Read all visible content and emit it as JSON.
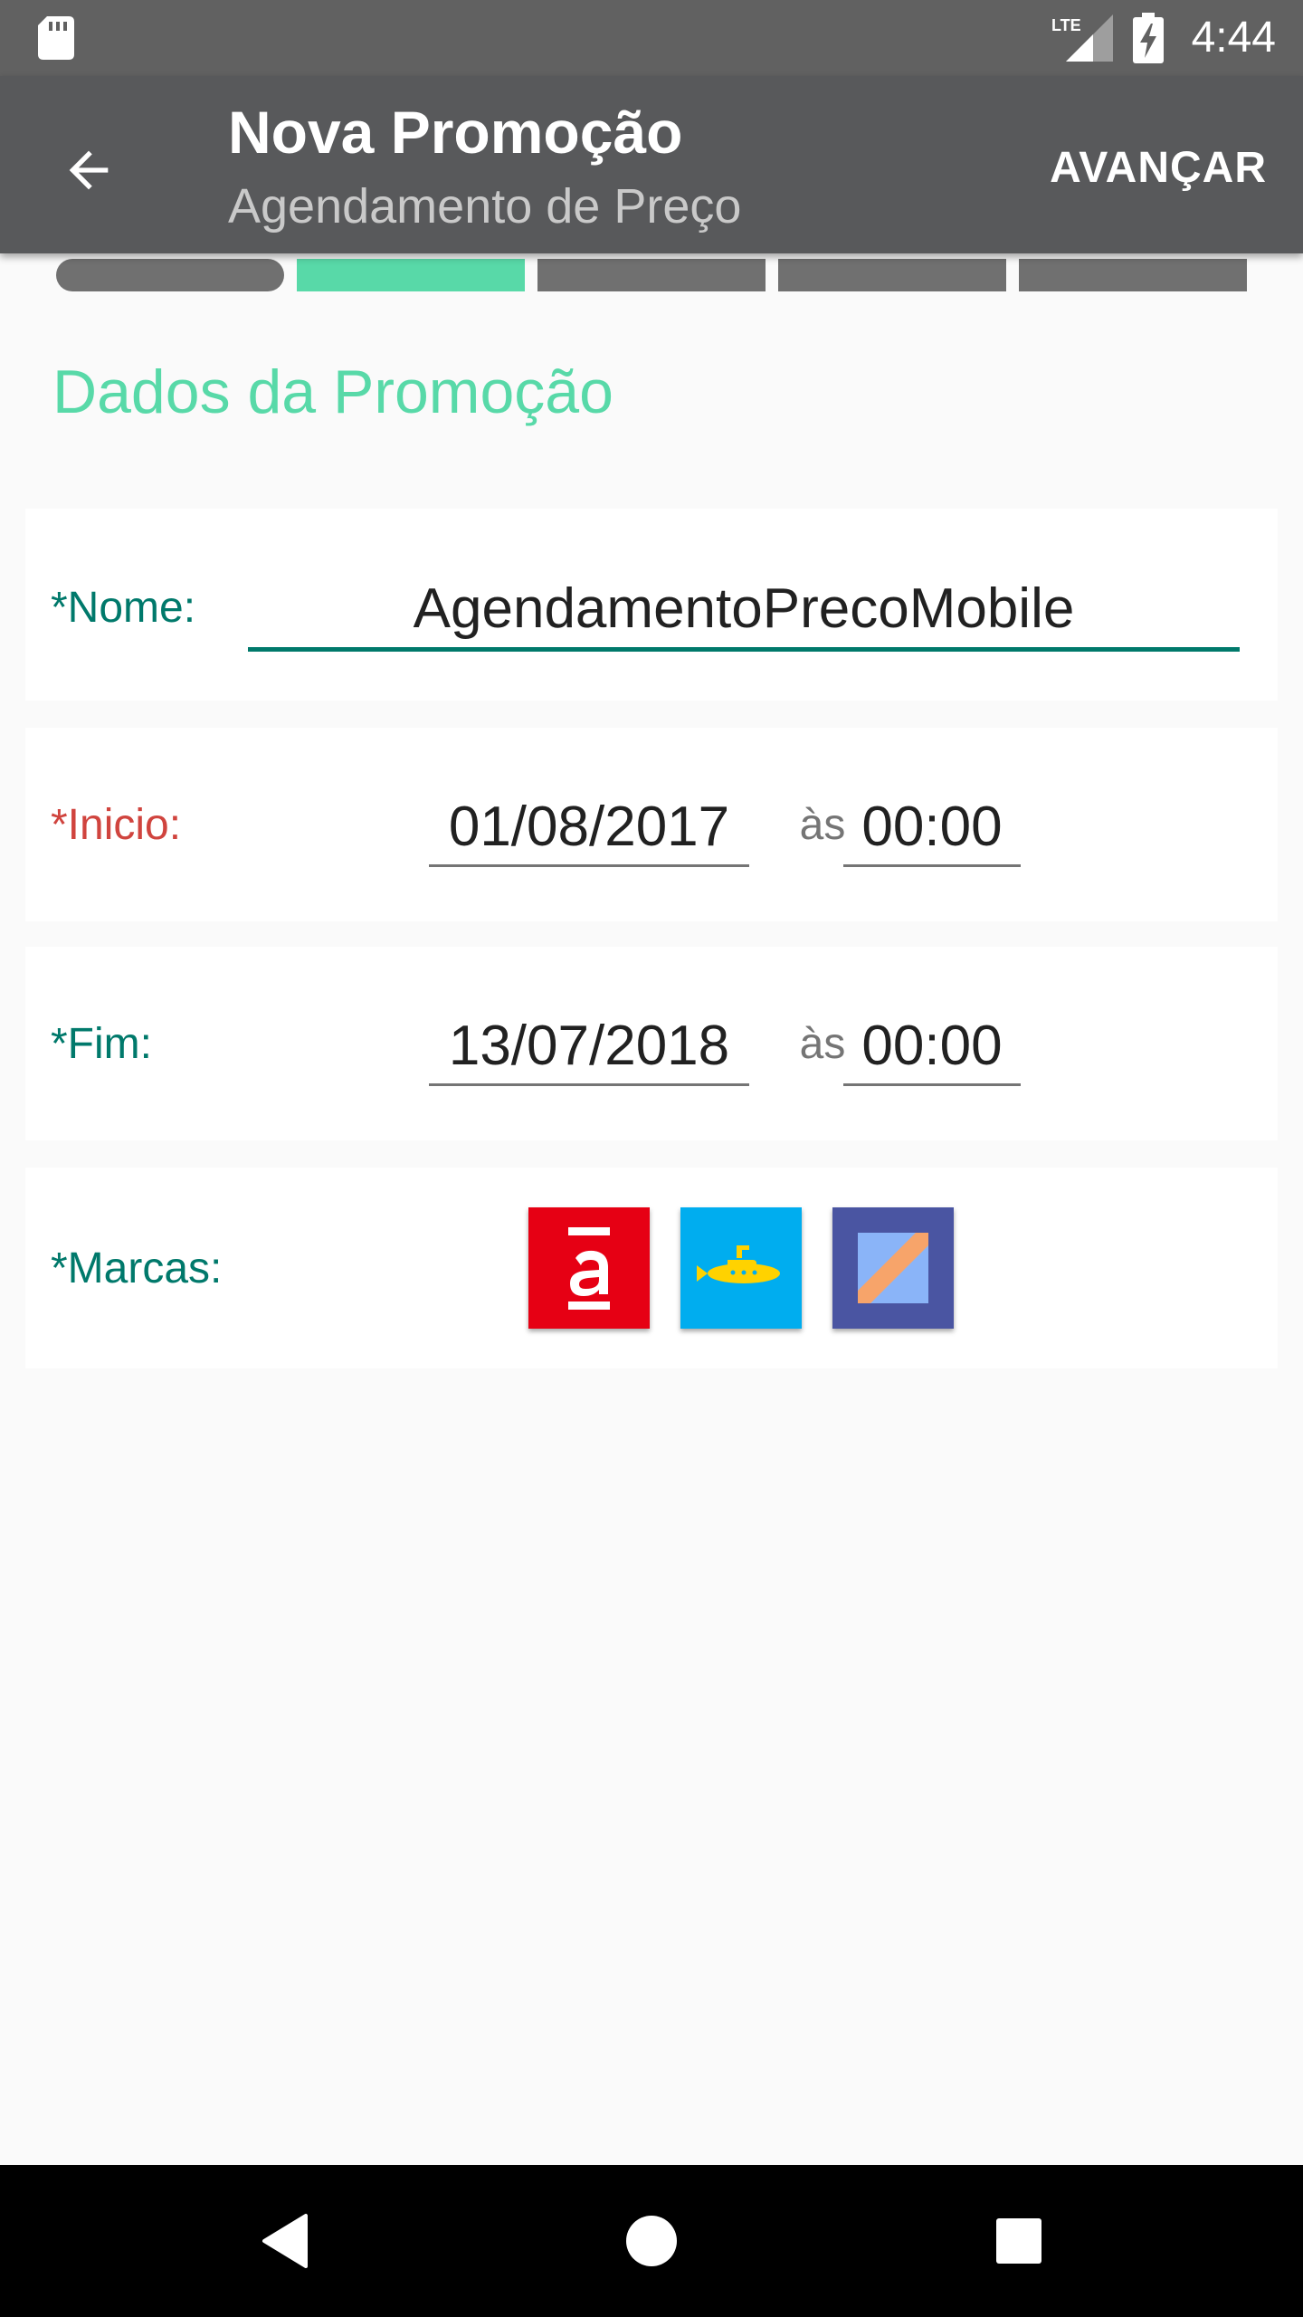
{
  "status_bar": {
    "time": "4:44",
    "network_label": "LTE",
    "icons": [
      "sd-card-icon",
      "lte-signal-icon",
      "battery-charging-icon"
    ]
  },
  "app_bar": {
    "title": "Nova Promoção",
    "subtitle": "Agendamento de Preço",
    "next_label": "AVANÇAR",
    "back_icon": "arrow-back-icon"
  },
  "steps": {
    "total": 5,
    "active_index": 1
  },
  "section_title": "Dados da Promoção",
  "form": {
    "nome": {
      "label": "*Nome:",
      "value": "AgendamentoPrecoMobile"
    },
    "inicio": {
      "label": "*Inicio:",
      "date": "01/08/2017",
      "separator": "às",
      "time": "00:00"
    },
    "fim": {
      "label": "*Fim:",
      "date": "13/07/2018",
      "separator": "às",
      "time": "00:00"
    },
    "marcas": {
      "label": "*Marcas:",
      "brands": [
        "americanas-logo",
        "submarino-logo",
        "shoptime-logo"
      ]
    }
  },
  "colors": {
    "accent": "#58d9a8",
    "label": "#00796b",
    "error": "#d0443e",
    "app_bar": "#58595b",
    "status_bar": "#616161"
  },
  "nav_bar": {
    "icons": [
      "nav-back-icon",
      "nav-home-icon",
      "nav-recents-icon"
    ]
  }
}
